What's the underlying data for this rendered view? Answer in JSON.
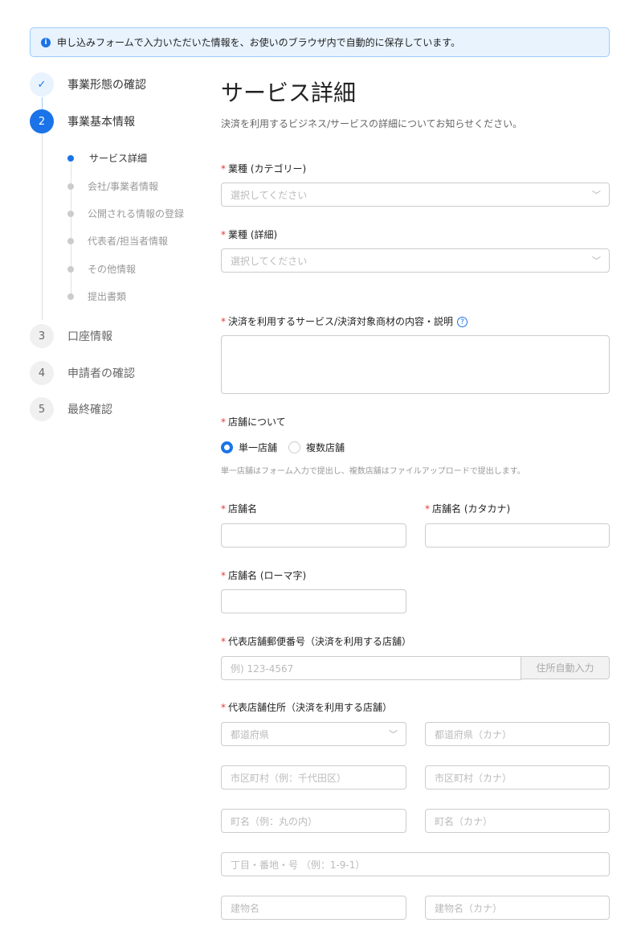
{
  "banner": {
    "text": "申し込みフォームで入力いただいた情報を、お使いのブラウザ内で自動的に保存しています。",
    "icon": "info-icon"
  },
  "steps": [
    {
      "num": "✓",
      "label": "事業形態の確認",
      "state": "done"
    },
    {
      "num": "2",
      "label": "事業基本情報",
      "state": "active"
    },
    {
      "num": "3",
      "label": "口座情報",
      "state": "todo"
    },
    {
      "num": "4",
      "label": "申請者の確認",
      "state": "todo"
    },
    {
      "num": "5",
      "label": "最終確認",
      "state": "todo"
    }
  ],
  "substeps": [
    "サービス詳細",
    "会社/事業者情報",
    "公開される情報の登録",
    "代表者/担当者情報",
    "その他情報",
    "提出書類"
  ],
  "main": {
    "title": "サービス詳細",
    "description": "決済を利用するビジネス/サービスの詳細についてお知らせください。",
    "category_label": "業種 (カテゴリー)",
    "category_placeholder": "選択してください",
    "detail_label": "業種 (詳細)",
    "detail_placeholder": "選択してください",
    "service_label": "決済を利用するサービス/決済対象商材の内容・説明",
    "store_label": "店舗について",
    "radio_single": "単一店舗",
    "radio_multi": "複数店舗",
    "store_hint": "単一店舗はフォーム入力で提出し、複数店舗はファイルアップロードで提出します。",
    "store_name_label": "店舗名",
    "store_kana_label": "店舗名 (カタカナ)",
    "store_roman_label": "店舗名 (ローマ字)",
    "postal_label": "代表店舗郵便番号（決済を利用する店舗）",
    "postal_placeholder": "例) 123-4567",
    "auto_fill": "住所自動入力",
    "address_label": "代表店舗住所（決済を利用する店舗）",
    "pref": "都道府県",
    "pref_kana": "都道府県（カナ）",
    "city": "市区町村（例：千代田区）",
    "city_kana": "市区町村（カナ）",
    "town": "町名（例：丸の内）",
    "town_kana": "町名（カナ）",
    "block": "丁目・番地・号 （例：1-9-1）",
    "building": "建物名",
    "building_kana": "建物名（カナ）"
  },
  "colors": {
    "accent": "#1a73e8",
    "required": "#e53935"
  }
}
